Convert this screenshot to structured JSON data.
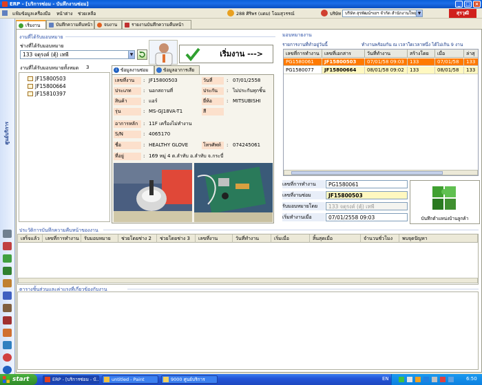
{
  "window": {
    "title": "ERP - [บริการซ่อม - บันทึกงานซ่อม]"
  },
  "menu": {
    "items": [
      "แฟ้มข้อมูล",
      "เครื่องมือ",
      "หน้าต่าง",
      "ช่วยเหลือ"
    ],
    "user": "288 ศิริพร (แดม) โฉมสุวรรณ์",
    "company_label": "บริษัท",
    "company": "บริษัท สุรพัฒน์ฯเยฯ จำกัด สำนักงานใหญ่",
    "logo_text": "สุรวุฒิ"
  },
  "sidebar": {
    "title": "ศูนย์บริการ"
  },
  "tabs": [
    "เริ่มงาน",
    "บันทึกความคืบหน้า",
    "จบงาน",
    "รายงานบันทึกความคืบหน้า"
  ],
  "left": {
    "assigned_section": "งานที่ได้รับมอบหมาย",
    "technician_label": "ช่างที่ได้รับมอบหมาย",
    "technician_value": "133 จตุรงค์ (ตุ้) เทพี",
    "total_label": "งานที่ได้รับมอบหมายทั้งหมด",
    "total_count": "3",
    "jobs": [
      "JF15800503",
      "JF15800664",
      "JF15810397"
    ]
  },
  "start_button": {
    "label": "เริ่มงาน --->"
  },
  "detail_tabs": [
    "ข้อมูลงานซ่อม",
    "ข้อมูลอาการเสีย"
  ],
  "detail": {
    "job_no_label": "เลขที่งาน",
    "job_no": "JF15800503",
    "date_label": "วันที่",
    "date": "07/01/2558",
    "type_label": "ประเภท",
    "type": "นอกสถานที่",
    "warranty_label": "ประกัน",
    "warranty": "ไม่ประกันทุกชิ้น",
    "product_label": "สินค้า",
    "product": "แอร์",
    "brand_label": "ยี่ห้อ",
    "brand": "MITSUBISHI",
    "model_label": "รุ่น",
    "model": "MS-GJ18VA-T1",
    "color_label": "สี",
    "color": "",
    "symptom_label": "อาการหลัก",
    "symptom": "11F เครื่องไม่ทำงาน",
    "sn_label": "S/N",
    "sn": "4065170",
    "name_label": "ชื่อ",
    "name": "HEALTHY GLOVE",
    "phone_label": "โทรศัพท์",
    "phone": "074245061",
    "address_label": "ที่อยู่",
    "address": "169 หมู่ 4 ต.ลำทับ อ.ลำทับ จ.กระบี่"
  },
  "right": {
    "section": "มอบหมายงาน",
    "today_label": "รายการงานที่ทำอยู่วันนี้",
    "note": "ทำงานพร้อมกัน ณ เวลาใดเวลาหนึ่ง ได้ไม่เกิน 9 งาน",
    "columns": [
      "เลขที่การทำงาน",
      "เลขที่เอกสาร",
      "วันที่ทำงาน",
      "สร้างโดย",
      "เมื่อ",
      "ล่าสุ"
    ],
    "rows": [
      [
        "PG1580061",
        "JF15800503",
        "07/01/58 09:03",
        "133",
        "07/01/58",
        "133"
      ],
      [
        "PG1580077",
        "JF15800664",
        "08/01/58 09:02",
        "133",
        "08/01/58",
        "133"
      ]
    ],
    "form": {
      "work_no_label": "เลขที่การทำงาน",
      "work_no": "PG1580061",
      "repair_no_label": "เลขที่งานซ่อม",
      "repair_no": "JF15800503",
      "assigned_by_label": "รับมอบหมายโดย",
      "assigned_by": "133  จตุรงค์ (ตุ้) เทพี",
      "start_time_label": "เริ่มทำงานเมื่อ",
      "start_time": "07/01/2558 09:03"
    },
    "save_location_label": "บันทึกตำแหน่งบ้านลูกค้า"
  },
  "history": {
    "title": "ประวัติการบันทึกความคืบหน้าของงาน",
    "columns": [
      "เสร็จแล้ว",
      "เลขที่การทำงาน",
      "รับมอบหมาย",
      "ช่วยโดยช่าง 2",
      "ช่วยโดยช่าง 3",
      "เลขที่งาน",
      "วันที่ทำงาน",
      "เริ่มเมื่อ",
      "สิ้นสุดเมื่อ",
      "จำนวนชั่วโมง",
      "พบจุดปัญหา"
    ]
  },
  "parts": {
    "title": "ตารางชิ้นส่วนและค่าแรงที่เกี่ยวข้องกับงาน"
  },
  "taskbar": {
    "start": "start",
    "items": [
      "ERP - [บริการซ่อม - บั...",
      "untitled - Paint",
      "9000 ศูนย์บริการ"
    ],
    "lang": "EN",
    "time": "6:50"
  },
  "colors": {
    "selected_row": "#ff7a00",
    "row_highlight": "#fff8c0",
    "label_bg": "#fce0cc",
    "accent": "#2a4fa8"
  }
}
